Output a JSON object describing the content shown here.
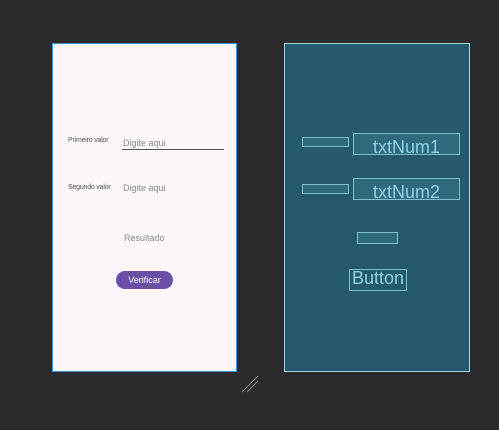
{
  "design": {
    "label1": "Primeiro valor",
    "input1_placeholder": "Digite aqui",
    "label2": "Segundo valor",
    "input2_placeholder": "Digite aqui",
    "result": "Resultado",
    "button": "Verificar"
  },
  "blueprint": {
    "txt1": "txtNum1",
    "txt2": "txtNum2",
    "button": "Button"
  },
  "icons": {
    "resize": "resize-handle-icon"
  }
}
